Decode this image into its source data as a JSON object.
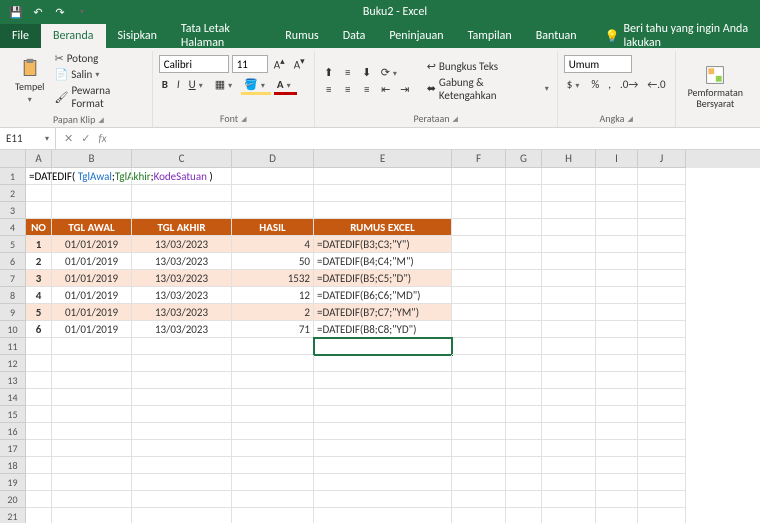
{
  "title": "Buku2 - Excel",
  "tabs": {
    "file": "File",
    "beranda": "Beranda",
    "sisipkan": "Sisipkan",
    "tata": "Tata Letak Halaman",
    "rumus": "Rumus",
    "data": "Data",
    "peninjauan": "Peninjauan",
    "tampilan": "Tampilan",
    "bantuan": "Bantuan",
    "tellme": "Beri tahu yang ingin Anda lakukan"
  },
  "ribbon": {
    "paste": "Tempel",
    "cut": "Potong",
    "copy": "Salin",
    "painter": "Pewarna Format",
    "clipboard_label": "Papan Klip",
    "font_label": "Font",
    "align_label": "Perataan",
    "number_label": "Angka",
    "font_name": "Calibri",
    "font_size": "11",
    "wrap": "Bungkus Teks",
    "merge": "Gabung & Ketengahkan",
    "number_format": "Umum",
    "cond": "Pemformatan Bersyarat"
  },
  "namebox": "E11",
  "fx": "fx",
  "formula_segments": {
    "eq": "=DATEDIF( ",
    "a": "TglAwal",
    "s1": ";",
    "b": "TglAkhir",
    "s2": ";",
    "c": "KodeSatuan",
    "end": " )"
  },
  "cols": [
    "A",
    "B",
    "C",
    "D",
    "E",
    "F",
    "G",
    "H",
    "I",
    "J"
  ],
  "headers": {
    "no": "NO",
    "awal": "TGL AWAL",
    "akhir": "TGL AKHIR",
    "hasil": "HASIL",
    "rumus": "RUMUS EXCEL"
  },
  "data": [
    {
      "no": "1",
      "awal": "01/01/2019",
      "akhir": "13/03/2023",
      "hasil": "4",
      "rumus": "=DATEDIF(B3;C3;\"Y\")"
    },
    {
      "no": "2",
      "awal": "01/01/2019",
      "akhir": "13/03/2023",
      "hasil": "50",
      "rumus": "=DATEDIF(B4;C4;\"M\")"
    },
    {
      "no": "3",
      "awal": "01/01/2019",
      "akhir": "13/03/2023",
      "hasil": "1532",
      "rumus": "=DATEDIF(B5;C5;\"D\")"
    },
    {
      "no": "4",
      "awal": "01/01/2019",
      "akhir": "13/03/2023",
      "hasil": "12",
      "rumus": "=DATEDIF(B6;C6;\"MD\")"
    },
    {
      "no": "5",
      "awal": "01/01/2019",
      "akhir": "13/03/2023",
      "hasil": "2",
      "rumus": "=DATEDIF(B7;C7;\"YM\")"
    },
    {
      "no": "6",
      "awal": "01/01/2019",
      "akhir": "13/03/2023",
      "hasil": "71",
      "rumus": "=DATEDIF(B8;C8;\"YD\")"
    }
  ]
}
